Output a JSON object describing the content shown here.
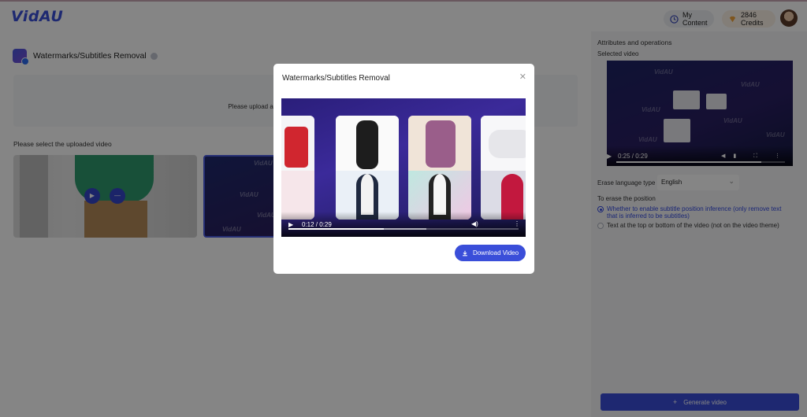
{
  "header": {
    "logo": "VidAU",
    "my_content": "My Content",
    "credits": "2846 Credits"
  },
  "page": {
    "title": "Watermarks/Subtitles Removal",
    "upload_hint": "Please upload a video file in the format of mp4/mov/m3",
    "select_label": "Please select the uploaded video"
  },
  "right_panel": {
    "title": "Attributes and operations",
    "selected_video": "Selected video",
    "video_time": "0:25 / 0:29",
    "video_progress": 0.862,
    "erase_language_label": "Erase language type",
    "erase_language_value": "English",
    "erase_position_label": "To erase the position",
    "options": [
      {
        "label": "Whether to enable subtitle position inference (only remove text that is inferred to be subtitles)",
        "selected": true
      },
      {
        "label": "Text at the top or bottom of the video (not on the video theme)",
        "selected": false
      }
    ],
    "generate_button": "Generate video"
  },
  "modal": {
    "title": "Watermarks/Subtitles Removal",
    "video_time": "0:12 / 0:29",
    "video_progress": 0.414,
    "download_button": "Download Video"
  },
  "colors": {
    "accent": "#3a4ed9",
    "overlay": "rgba(0,0,0,0.48)"
  }
}
